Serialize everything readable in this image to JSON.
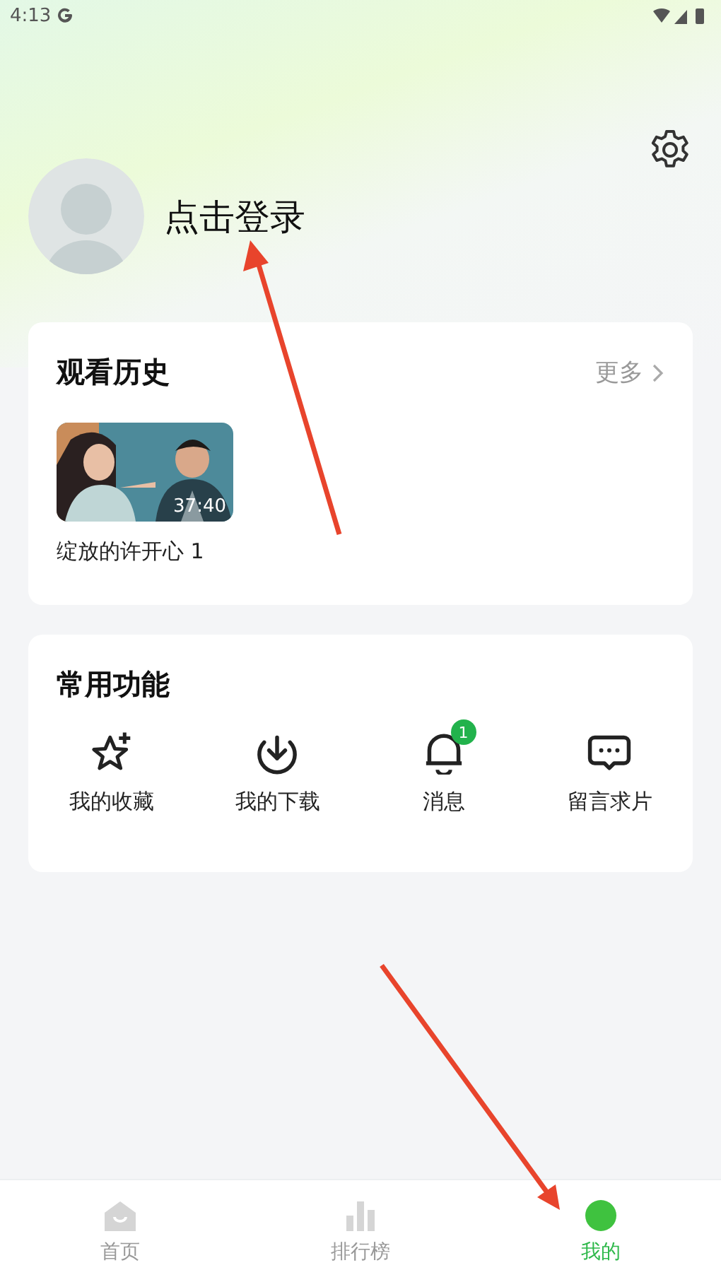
{
  "status_bar": {
    "time": "4:13"
  },
  "profile": {
    "login": "点击登录"
  },
  "history": {
    "title": "观看历史",
    "more": "更多",
    "items": [
      {
        "title": "绽放的许开心 1",
        "duration": "37:40"
      }
    ]
  },
  "functions": {
    "title": "常用功能",
    "items": [
      {
        "label": "我的收藏"
      },
      {
        "label": "我的下载"
      },
      {
        "label": "消息",
        "badge": "1"
      },
      {
        "label": "留言求片"
      }
    ]
  },
  "nav": [
    {
      "label": "首页",
      "selected": false
    },
    {
      "label": "排行榜",
      "selected": false
    },
    {
      "label": "我的",
      "selected": true
    }
  ]
}
